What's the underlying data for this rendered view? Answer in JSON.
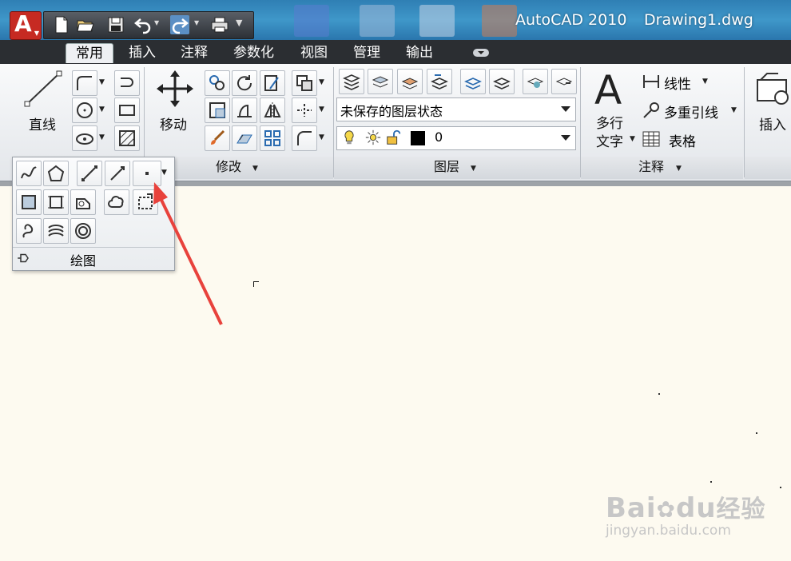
{
  "titlebar": {
    "app_name": "AutoCAD 2010",
    "file_name": "Drawing1.dwg"
  },
  "tabs": [
    {
      "label": "常用",
      "active": true
    },
    {
      "label": "插入",
      "active": false
    },
    {
      "label": "注释",
      "active": false
    },
    {
      "label": "参数化",
      "active": false
    },
    {
      "label": "视图",
      "active": false
    },
    {
      "label": "管理",
      "active": false
    },
    {
      "label": "输出",
      "active": false
    }
  ],
  "ribbon": {
    "draw": {
      "line_label": "直线"
    },
    "modify": {
      "move_label": "移动",
      "panel_label": "修改"
    },
    "layers": {
      "state_value": "未保存的图层状态",
      "current_layer": "0",
      "panel_label": "图层"
    },
    "annotation": {
      "mtext_line1": "多行",
      "mtext_line2": "文字",
      "linear_label": "线性",
      "mleader_label": "多重引线",
      "table_label": "表格",
      "panel_label": "注释"
    },
    "block": {
      "insert_label": "插入"
    }
  },
  "draw_flyout": {
    "panel_label": "绘图"
  },
  "watermark": {
    "brand": "Bai",
    "brand2": "du",
    "brand_cn": "经验",
    "url": "jingyan.baidu.com"
  },
  "colors": {
    "accent_red": "#e8423c",
    "title_blue": "#3a8bc0",
    "canvas": "#fdfaf0"
  }
}
